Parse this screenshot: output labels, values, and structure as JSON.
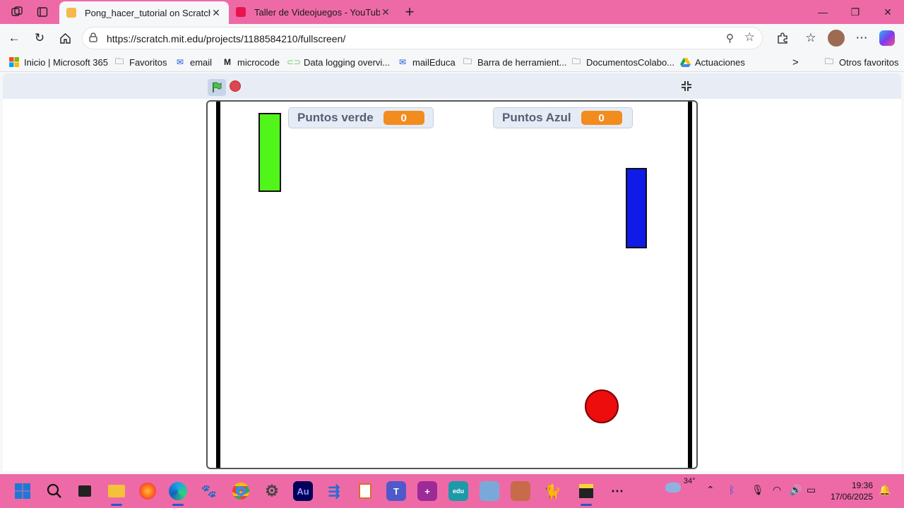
{
  "browser": {
    "tabs": [
      {
        "title": "Pong_hacer_tutorial on Scratch",
        "active": true,
        "favicon_color": "#f7b84b"
      },
      {
        "title": "Taller de Videojuegos - YouTube",
        "active": false,
        "favicon_color": "#e8154a"
      }
    ],
    "new_tab": "+",
    "url": "https://scratch.mit.edu/projects/1188584210/fullscreen/",
    "icons": {
      "back": "arrow-left-icon",
      "refresh": "refresh-icon",
      "home": "home-icon",
      "lock": "lock-icon",
      "zoom": "zoom-out-icon",
      "favorite": "star-icon",
      "extensions": "puzzle-icon",
      "favorites_bar": "favorites-icon",
      "menu": "more-icon",
      "profile": "avatar",
      "copilot": "copilot-icon"
    }
  },
  "bookmarks": [
    {
      "label": "Inicio | Microsoft 365",
      "icon": "microsoft-icon"
    },
    {
      "label": "Favoritos",
      "icon": "folder-icon"
    },
    {
      "label": "email",
      "icon": "mail-icon"
    },
    {
      "label": "microcode",
      "icon": "microbit-icon"
    },
    {
      "label": "Data logging overvi...",
      "icon": "link-icon"
    },
    {
      "label": "mailEduca",
      "icon": "mail-icon"
    },
    {
      "label": "Barra de herramient...",
      "icon": "folder-icon"
    },
    {
      "label": "DocumentosColabo...",
      "icon": "folder-icon"
    },
    {
      "label": "Actuaciones",
      "icon": "drive-icon"
    }
  ],
  "bookmarks_more": ">",
  "other_bookmarks": "Otros favoritos",
  "game": {
    "score_green_label": "Puntos verde",
    "score_green_value": "0",
    "score_blue_label": "Puntos Azul",
    "score_blue_value": "0"
  },
  "taskbar": {
    "weather": "34°",
    "time": "19:36",
    "date": "17/06/2025",
    "apps": [
      "windows-start",
      "search",
      "task-view",
      "file-explorer",
      "firefox",
      "edge",
      "gimp",
      "chrome",
      "settings",
      "audition",
      "power-automate",
      "forms",
      "teams",
      "power-apps",
      "edu-app",
      "remote-app",
      "cart-app",
      "scratch-cat",
      "sticky-notes",
      "more"
    ]
  }
}
